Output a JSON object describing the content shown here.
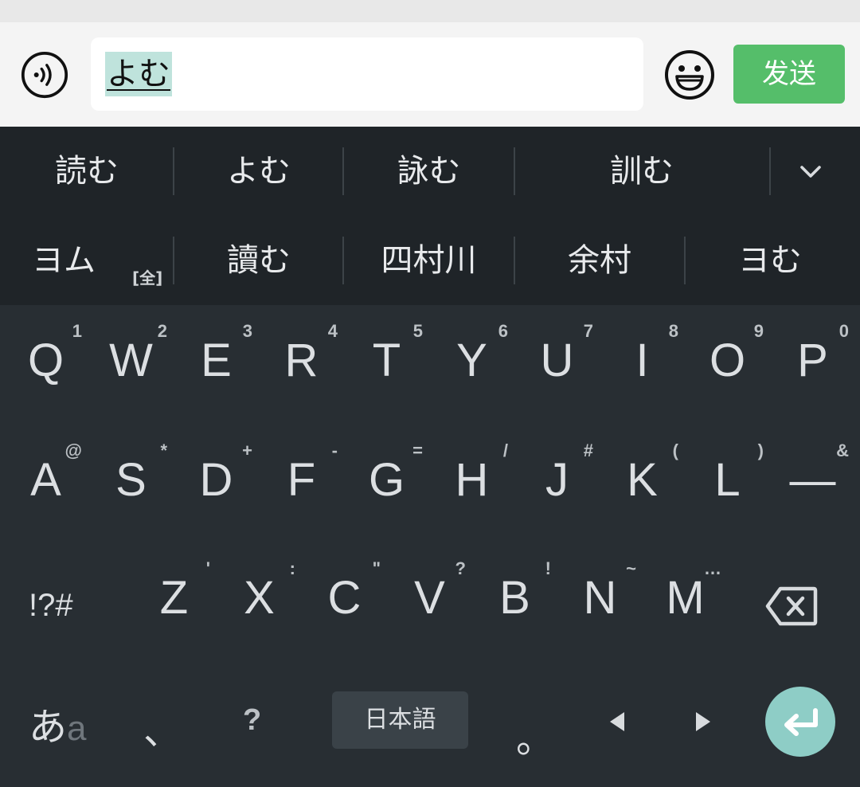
{
  "input": {
    "composing_text": "よむ"
  },
  "send_label": "发送",
  "candidates_row1": [
    "読む",
    "よむ",
    "詠む",
    "訓む"
  ],
  "candidates_row2": [
    "ヨム",
    "讀む",
    "四村川",
    "余村",
    "ヨむ"
  ],
  "width_badge": "[全]",
  "keys_row1": [
    {
      "label": "Q",
      "hint": "1"
    },
    {
      "label": "W",
      "hint": "2"
    },
    {
      "label": "E",
      "hint": "3"
    },
    {
      "label": "R",
      "hint": "4"
    },
    {
      "label": "T",
      "hint": "5"
    },
    {
      "label": "Y",
      "hint": "6"
    },
    {
      "label": "U",
      "hint": "7"
    },
    {
      "label": "I",
      "hint": "8"
    },
    {
      "label": "O",
      "hint": "9"
    },
    {
      "label": "P",
      "hint": "0"
    }
  ],
  "keys_row2": [
    {
      "label": "A",
      "hint": "@"
    },
    {
      "label": "S",
      "hint": "*"
    },
    {
      "label": "D",
      "hint": "+"
    },
    {
      "label": "F",
      "hint": "-"
    },
    {
      "label": "G",
      "hint": "="
    },
    {
      "label": "H",
      "hint": "/"
    },
    {
      "label": "J",
      "hint": "#"
    },
    {
      "label": "K",
      "hint": "("
    },
    {
      "label": "L",
      "hint": ")"
    },
    {
      "label": "—",
      "hint": "&"
    }
  ],
  "keys_row3": [
    {
      "label": "Z",
      "hint": "'"
    },
    {
      "label": "X",
      "hint": ":"
    },
    {
      "label": "C",
      "hint": "\""
    },
    {
      "label": "V",
      "hint": "?"
    },
    {
      "label": "B",
      "hint": "!"
    },
    {
      "label": "N",
      "hint": "~"
    },
    {
      "label": "M",
      "hint": "…"
    }
  ],
  "symbols_key": "!?#",
  "mode_key": {
    "kana": "あ",
    "alpha": "a"
  },
  "comma_key": "、",
  "question_key": "?",
  "space_label": "日本語",
  "period_key": "。",
  "colors": {
    "send": "#55be6a",
    "enter": "#8ecdc6",
    "highlight": "#bfe3dc",
    "keyboard_bg": "#282e33"
  },
  "icons": [
    "voice-icon",
    "emoji-icon",
    "chevron-down-icon",
    "backspace-icon",
    "left-arrow-icon",
    "right-arrow-icon",
    "enter-icon"
  ]
}
